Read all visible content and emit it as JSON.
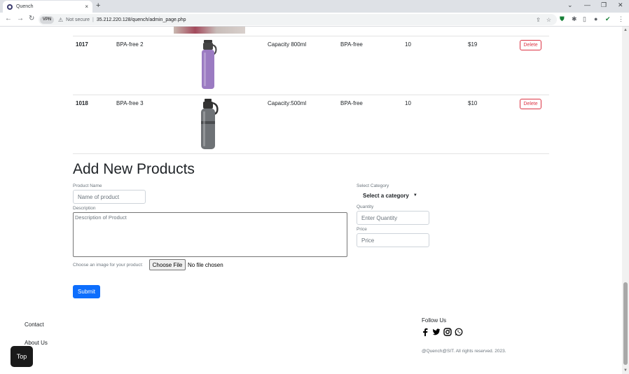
{
  "browser": {
    "tab_title": "Quench",
    "tab_close": "×",
    "new_tab": "+",
    "win_min": "⌄",
    "win_dash": "—",
    "win_max": "❐",
    "win_close": "✕",
    "vpn_label": "VPN",
    "security_text": "Not secure",
    "separator": "|",
    "url": "35.212.220.128/quench/admin_page.php"
  },
  "products": [
    {
      "id": "1017",
      "name": "BPA-free 2",
      "capacity": "Capacity 800ml",
      "type": "BPA-free",
      "quantity": "10",
      "price": "$19",
      "delete_label": "Delete",
      "bottle_color": "#9b7bc2"
    },
    {
      "id": "1018",
      "name": "BPA-free 3",
      "capacity": "Capacity:500ml",
      "type": "BPA-free",
      "quantity": "10",
      "price": "$10",
      "delete_label": "Delete",
      "bottle_color": "#6e7276"
    }
  ],
  "form": {
    "heading": "Add New Products",
    "product_name_label": "Product Name",
    "product_name_placeholder": "Name of product",
    "description_label": "Description",
    "description_placeholder": "Description of Product",
    "category_label": "Select Category",
    "category_selected": "Select a category",
    "quantity_label": "Quantity",
    "quantity_placeholder": "Enter Quantity",
    "price_label": "Price",
    "price_placeholder": "Price",
    "image_label": "Choose an image for your product:",
    "file_button": "Choose File",
    "file_status": "No file chosen",
    "submit_label": "Submit"
  },
  "footer": {
    "contact": "Contact",
    "about": "About Us",
    "follow_us": "Follow Us",
    "copyright": "@Quench@SIT. All rights reserved. 2023.",
    "top_button": "Top",
    "social_icons": [
      "facebook-icon",
      "twitter-icon",
      "instagram-icon",
      "whatsapp-icon"
    ]
  },
  "colors": {
    "primary": "#0d6efd",
    "danger": "#dc3545"
  }
}
